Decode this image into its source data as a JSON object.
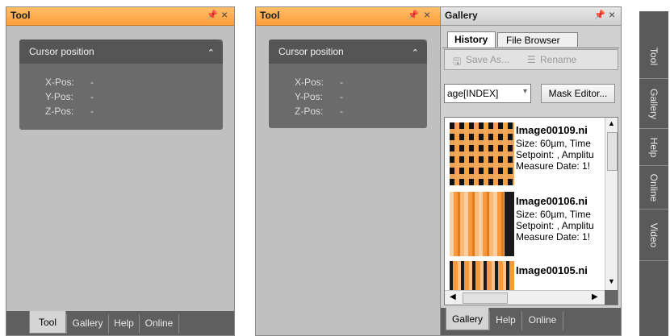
{
  "left_panel": {
    "title": "Tool",
    "pin_icon": "pin-icon",
    "close_icon": "close-icon",
    "cursor": {
      "heading": "Cursor position",
      "rows": [
        {
          "label": "X-Pos:",
          "value": "-"
        },
        {
          "label": "Y-Pos:",
          "value": "-"
        },
        {
          "label": "Z-Pos:",
          "value": "-"
        }
      ]
    },
    "tabs": [
      "Tool",
      "Gallery",
      "Help",
      "Online"
    ],
    "active_tab": "Tool"
  },
  "middle_panel": {
    "title": "Tool",
    "cursor": {
      "heading": "Cursor position",
      "rows": [
        {
          "label": "X-Pos:",
          "value": "-"
        },
        {
          "label": "Y-Pos:",
          "value": "-"
        },
        {
          "label": "Z-Pos:",
          "value": "-"
        }
      ]
    }
  },
  "gallery_panel": {
    "title": "Gallery",
    "tabs": [
      "History",
      "File Browser"
    ],
    "active_tab": "History",
    "toolbar": {
      "save_as": "Save As...",
      "rename": "Rename"
    },
    "channel_select": "age[INDEX]",
    "mask_editor": "Mask Editor...",
    "items": [
      {
        "name": "Image00109.ni",
        "size": "Size: 60µm, Time",
        "setpoint": "Setpoint: , Amplitu",
        "date": "Measure Date: 1!"
      },
      {
        "name": "Image00106.ni",
        "size": "Size: 60µm, Time",
        "setpoint": "Setpoint: , Amplitu",
        "date": "Measure Date: 1!"
      },
      {
        "name": "Image00105.ni",
        "size": "",
        "setpoint": "",
        "date": ""
      }
    ],
    "bottom_tabs": [
      "Gallery",
      "Help",
      "Online"
    ],
    "active_bottom_tab": "Gallery"
  },
  "side_bar": {
    "tabs": [
      "Tool",
      "Gallery",
      "Help",
      "Online",
      "Video"
    ]
  },
  "colors": {
    "accent": "#ff9d3a",
    "panel_bg": "#c0c0c0",
    "dark": "#5f5f5f"
  }
}
